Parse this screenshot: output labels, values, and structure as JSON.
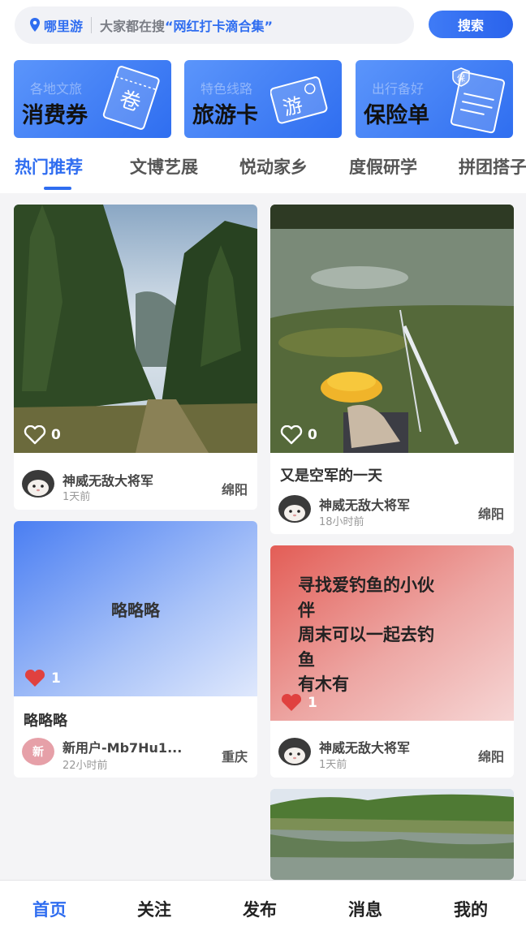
{
  "search": {
    "location": "哪里游",
    "hot_prefix": "大家都在搜",
    "hot_term": "“网红打卡滴合集”",
    "button_label": "搜索"
  },
  "services": [
    {
      "subtitle": "各地文旅",
      "title": "消费券",
      "deco_text": "卷"
    },
    {
      "subtitle": "特色线路",
      "title": "旅游卡",
      "deco_text": "游"
    },
    {
      "subtitle": "出行备好",
      "title": "保险单",
      "deco_text": "保"
    }
  ],
  "tabs": [
    {
      "label": "热门推荐",
      "active": true
    },
    {
      "label": "文博艺展",
      "active": false
    },
    {
      "label": "悦动家乡",
      "active": false
    },
    {
      "label": "度假研学",
      "active": false
    },
    {
      "label": "拼团搭子",
      "active": false
    }
  ],
  "feed": {
    "left": [
      {
        "cover": "photo-forest-road",
        "likes": "0",
        "liked": false,
        "title": "",
        "author": "神威无敌大将军",
        "time": "1天前",
        "city": "绵阳",
        "avatar": "rabbit-avatar"
      },
      {
        "cover_text": "略略略",
        "likes": "1",
        "liked": true,
        "title": "略略略",
        "author": "新用户-Mb7Hu1...",
        "time": "22小时前",
        "city": "重庆",
        "avatar_text": "新"
      }
    ],
    "right": [
      {
        "cover": "photo-fishing-pond",
        "likes": "0",
        "liked": false,
        "title": "又是空军的一天",
        "author": "神威无敌大将军",
        "time": "18小时前",
        "city": "绵阳",
        "avatar": "rabbit-avatar"
      },
      {
        "cover_lines": [
          "寻找爱钓鱼的小伙",
          "伴",
          "周末可以一起去钓",
          "鱼",
          "有木有"
        ],
        "likes": "1",
        "liked": true,
        "title": "",
        "author": "神威无敌大将军",
        "time": "1天前",
        "city": "绵阳",
        "avatar": "rabbit-avatar"
      },
      {
        "cover": "photo-pond-trees"
      }
    ]
  },
  "bottom_nav": [
    {
      "label": "首页",
      "active": true
    },
    {
      "label": "关注",
      "active": false
    },
    {
      "label": "发布",
      "active": false
    },
    {
      "label": "消息",
      "active": false
    },
    {
      "label": "我的",
      "active": false
    }
  ],
  "colors": {
    "accent": "#2f6df0",
    "like_red": "#e0413f",
    "feed_bg": "#f4f4f6"
  }
}
